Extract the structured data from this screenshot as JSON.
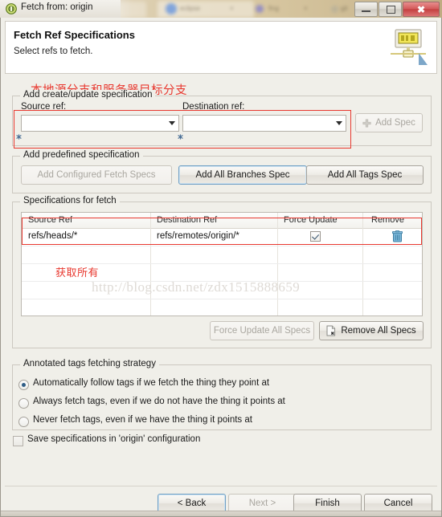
{
  "window": {
    "title": "Fetch from: origin",
    "icon": "git-repository-icon",
    "minimize_label": "Minimize",
    "maximize_label": "Maximize",
    "close_label": "Close"
  },
  "banner": {
    "title": "Fetch Ref Specifications",
    "subtitle": "Select refs to fetch.",
    "icon": "fetch-wizard-banner-icon"
  },
  "annotations": {
    "note_top": "本地源分支和服务器目标分支",
    "note_table": "获取所有",
    "watermark": "http://blog.csdn.net/zdx1515888659",
    "highlight_color": "#e8382f"
  },
  "create_update_group": {
    "legend": "Add create/update specification",
    "source_ref": {
      "label": "Source ref:",
      "value": "",
      "placeholder": ""
    },
    "destination_ref": {
      "label": "Destination ref:",
      "value": "",
      "placeholder": ""
    },
    "add_spec_button": {
      "label": "Add Spec",
      "icon": "plus-icon",
      "enabled": false
    }
  },
  "predefined_group": {
    "legend": "Add predefined specification",
    "buttons": [
      {
        "label": "Add Configured Fetch Specs",
        "enabled": false
      },
      {
        "label": "Add All Branches Spec",
        "enabled": true
      },
      {
        "label": "Add All Tags Spec",
        "enabled": true
      }
    ]
  },
  "specs_group": {
    "legend": "Specifications for fetch",
    "columns": [
      "Source Ref",
      "Destination Ref",
      "Force Update",
      "Remove"
    ],
    "rows": [
      {
        "source_ref": "refs/heads/*",
        "destination_ref": "refs/remotes/origin/*",
        "force_update": true,
        "remove_icon": "trash-icon"
      }
    ],
    "footer_buttons": [
      {
        "label": "Force Update All Specs",
        "enabled": false,
        "icon": ""
      },
      {
        "label": "Remove All Specs",
        "enabled": true,
        "icon": "remove-all-icon"
      }
    ]
  },
  "tags_group": {
    "legend": "Annotated tags fetching strategy",
    "options": [
      {
        "label": "Automatically follow tags if we fetch the thing they point at",
        "selected": true
      },
      {
        "label": "Always fetch tags, even if we do not have the thing it points at",
        "selected": false
      },
      {
        "label": "Never fetch tags, even if we have the thing it points at",
        "selected": false
      }
    ]
  },
  "save_checkbox": {
    "label": "Save specifications in 'origin' configuration",
    "checked": false
  },
  "footer": {
    "buttons": [
      {
        "label": "< Back",
        "mnemonic": "B",
        "enabled": true,
        "focused": true
      },
      {
        "label": "Next >",
        "mnemonic": "N",
        "enabled": false,
        "focused": false
      },
      {
        "label": "Finish",
        "mnemonic": "F",
        "enabled": true,
        "focused": false
      },
      {
        "label": "Cancel",
        "mnemonic": "",
        "enabled": true,
        "focused": false
      }
    ]
  }
}
